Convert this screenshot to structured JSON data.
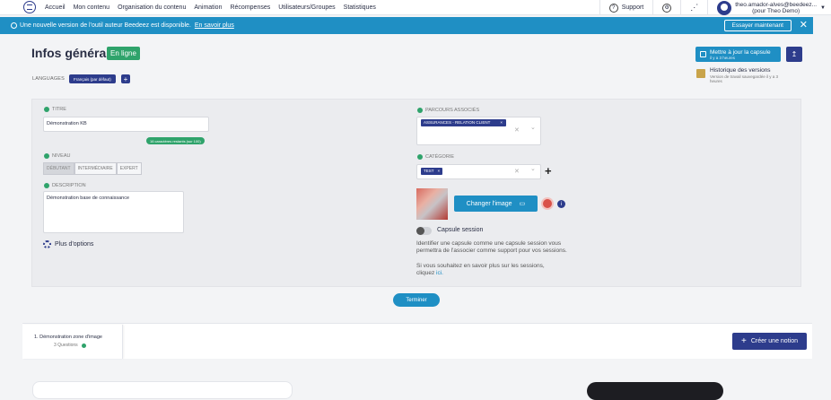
{
  "nav": {
    "links": [
      "Accueil",
      "Mon contenu",
      "Organisation du contenu",
      "Animation",
      "Récompenses",
      "Utilisateurs/Groupes",
      "Statistiques"
    ],
    "support_label": "Support",
    "user_email": "theo.amador-alves@beedeez...",
    "user_sub": "(pour Theo Demo)"
  },
  "banner": {
    "text": "Une nouvelle version de l'outil auteur Beedeez est disponible.",
    "link": "En savoir plus",
    "try_button": "Essayer maintenant",
    "close": "✕"
  },
  "header": {
    "title": "Infos générales",
    "status_badge": "En ligne",
    "languages_label": "LANGUAGES",
    "language_chip": "Français (par défaut)",
    "add_language": "+",
    "update_button": "Mettre à jour la capsule",
    "update_sub": "il y a 3 heures",
    "export_icon": "↥",
    "history_title": "Historique des versions",
    "history_sub": "Version de travail sauvegardée il y a 3 heures"
  },
  "form": {
    "title_label": "TITRE",
    "title_value": "Démonstration KB",
    "title_helper": "16 caractères restants (sur 100)",
    "level_label": "NIVEAU",
    "levels": [
      "DÉBUTANT",
      "INTERMÉDIAIRE",
      "EXPERT"
    ],
    "description_label": "DESCRIPTION",
    "description_value": "Démonstration base de connaissance",
    "more_options": "Plus d'options",
    "paths_label": "PARCOURS ASSOCIÉS",
    "path_chip": "ASSURANCES - RELATION CLIENT",
    "category_label": "CATÉGORIE",
    "category_chip": "TEST",
    "chip_remove": "×",
    "clear_icon": "✕",
    "dropdown_icon": "⌄",
    "add_category": "+",
    "change_image_button": "Changer l'image",
    "info_icon": "i",
    "session_toggle_label": "Capsule session",
    "session_desc": "Identifier une capsule comme une capsule session vous permettra de l'associer comme support pour vos sessions.",
    "session_more_prefix": "Si vous souhaitez en savoir plus sur les sessions, cliquez",
    "session_more_link": "ici."
  },
  "finish_button": "Terminer",
  "bottom": {
    "step_title": "1. Démonstration zone d'image",
    "step_sub": "3 Questions",
    "create_button": "Créer une notion",
    "create_plus": "+"
  }
}
